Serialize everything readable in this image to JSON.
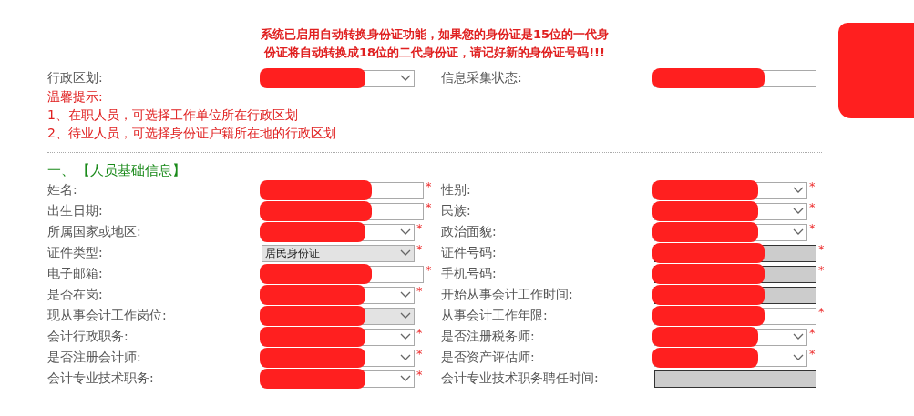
{
  "notice": [
    "系统已启用自动转换身份证功能，如果您的身份证是15位的一代身",
    "份证将自动转换成18位的二代身份证，请记好新的身份证号码!!!"
  ],
  "corner_redacted": true,
  "top_row": [
    {
      "label": "行政区划:",
      "kind": "select",
      "disabled": false,
      "redacted": true
    },
    {
      "label": "信息采集状态:",
      "kind": "text",
      "disabled": false,
      "redacted": true
    }
  ],
  "tips": {
    "title": "温馨提示:",
    "lines": [
      "1、在职人员，可选择工作单位所在行政区划",
      "2、待业人员，可选择身份证户籍所在地的行政区划"
    ]
  },
  "section": {
    "number": "一、",
    "title": "【人员基础信息】"
  },
  "rows": [
    [
      {
        "label": "姓名:",
        "kind": "text",
        "required_mark": "*",
        "disabled": false,
        "redacted": true
      },
      {
        "label": "性别:",
        "kind": "select",
        "required_mark": "*",
        "disabled": false,
        "redacted": true
      }
    ],
    [
      {
        "label": "出生日期:",
        "kind": "text",
        "required_mark": "*",
        "disabled": false,
        "redacted": true
      },
      {
        "label": "民族:",
        "kind": "select",
        "required_mark": "*",
        "disabled": false,
        "redacted": true
      }
    ],
    [
      {
        "label": "所属国家或地区:",
        "kind": "select",
        "required_mark": "*",
        "disabled": false,
        "redacted": true
      },
      {
        "label": "政治面貌:",
        "kind": "select",
        "required_mark": "*",
        "disabled": false,
        "redacted": true
      }
    ],
    [
      {
        "label": "证件类型:",
        "kind": "select",
        "required_mark": "*",
        "disabled": true,
        "redacted": false,
        "value": "居民身份证"
      },
      {
        "label": "证件号码:",
        "kind": "text",
        "required_mark": "*",
        "disabled": true,
        "redacted": true
      }
    ],
    [
      {
        "label": "电子邮箱:",
        "kind": "text",
        "required_mark": "*",
        "disabled": false,
        "redacted": true
      },
      {
        "label": "手机号码:",
        "kind": "text",
        "required_mark": "*",
        "disabled": true,
        "redacted": true
      }
    ],
    [
      {
        "label": "是否在岗:",
        "kind": "select",
        "required_mark": "*",
        "disabled": false,
        "redacted": true
      },
      {
        "label": "开始从事会计工作时间:",
        "kind": "text",
        "disabled": true,
        "redacted": true
      }
    ],
    [
      {
        "label": "现从事会计工作岗位:",
        "kind": "select",
        "disabled": true,
        "redacted": true
      },
      {
        "label": "从事会计工作年限:",
        "kind": "text",
        "required_mark": "*",
        "disabled": false,
        "redacted": true
      }
    ],
    [
      {
        "label": "会计行政职务:",
        "kind": "select",
        "required_mark": "*",
        "disabled": false,
        "redacted": true
      },
      {
        "label": "是否注册税务师:",
        "kind": "select",
        "required_mark": "*",
        "disabled": false,
        "redacted": true
      }
    ],
    [
      {
        "label": "是否注册会计师:",
        "kind": "select",
        "required_mark": "*",
        "disabled": false,
        "redacted": true
      },
      {
        "label": "是否资产评估师:",
        "kind": "select",
        "required_mark": "*",
        "disabled": false,
        "redacted": true
      }
    ],
    [
      {
        "label": "会计专业技术职务:",
        "kind": "select",
        "required_mark": "*",
        "disabled": false,
        "redacted": true
      },
      {
        "label": "会计专业技术职务聘任时间:",
        "kind": "text",
        "disabled": true,
        "redacted": false
      }
    ]
  ]
}
